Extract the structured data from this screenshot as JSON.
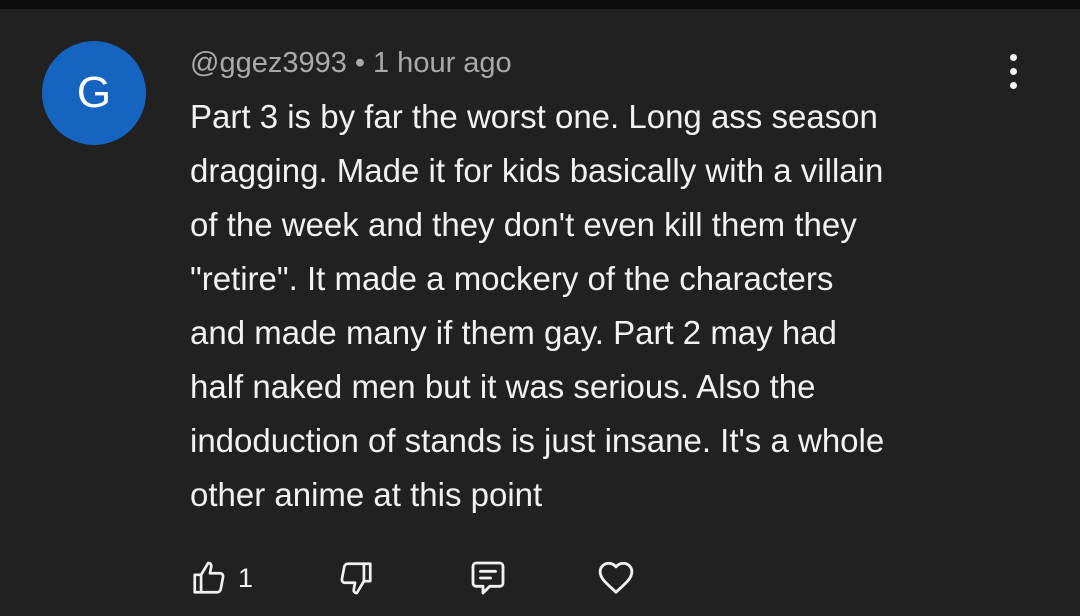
{
  "comment": {
    "avatar_letter": "G",
    "username": "@ggez3993",
    "separator": "•",
    "timestamp": "1 hour ago",
    "text": "Part 3 is by far the worst one. Long ass season\ndragging. Made it for kids basically with a villain\nof the week and they don't even kill them they\n\"retire\". It made a mockery of the characters\nand made many if them gay. Part 2 may had\nhalf naked men but it was serious. Also the\nindoduction of stands is just insane. It's a whole\nother anime at this point",
    "like_count": "1"
  },
  "icons": {
    "more": "more-vertical-icon",
    "like": "thumbs-up-icon",
    "dislike": "thumbs-down-icon",
    "reply": "reply-comment-icon",
    "heart": "heart-icon"
  },
  "colors": {
    "background": "#212121",
    "avatar": "#1565c0",
    "primary_text": "#f1f1f1",
    "secondary_text": "#aaaaaa"
  }
}
